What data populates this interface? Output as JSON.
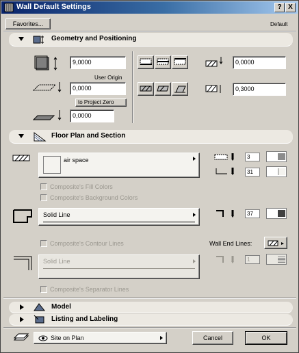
{
  "window": {
    "title": "Wall Default Settings",
    "help_button": "?",
    "close_button": "X"
  },
  "toolbar": {
    "favorites_label": "Favorites...",
    "default_label": "Default"
  },
  "geometry": {
    "title": "Geometry and Positioning",
    "height_value": "9,0000",
    "user_origin_label": "User Origin",
    "offset_value": "0,0000",
    "project_zero_label": "to Project Zero",
    "base_value": "0,0000",
    "right_top_value": "0,0000",
    "thickness_value": "0,3000"
  },
  "floor_plan": {
    "title": "Floor Plan and Section",
    "fill_name": "air space",
    "pen_fill": "3",
    "pen_bg": "31",
    "composite_fill_colors": "Composite's Fill Colors",
    "composite_bg_colors": "Composite's Background Colors",
    "contour_line": "Solid Line",
    "contour_pen": "37",
    "composite_contour_lines": "Composite's Contour Lines",
    "wall_end_lines_label": "Wall End Lines:",
    "separator_line": "Solid Line",
    "separator_pen": "1",
    "composite_separator_lines": "Composite's Separator Lines"
  },
  "model": {
    "title": "Model"
  },
  "listing": {
    "title": "Listing and Labeling"
  },
  "footer": {
    "layer_name": "Site on Plan",
    "cancel_label": "Cancel",
    "ok_label": "OK"
  },
  "colors": {
    "title_gradient_start": "#0a246a",
    "title_gradient_end": "#a6caf0",
    "face": "#d4d0c8"
  }
}
